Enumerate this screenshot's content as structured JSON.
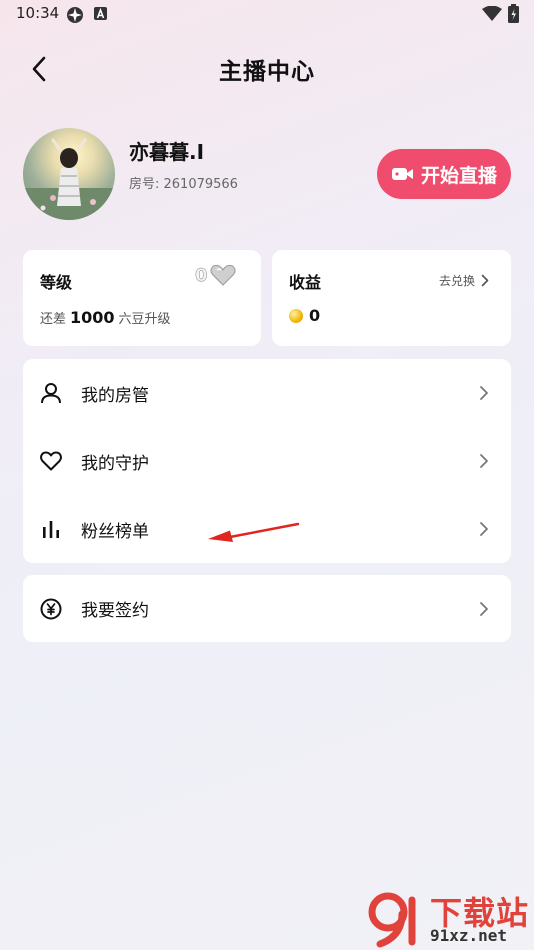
{
  "status_bar": {
    "time": "10:34",
    "icons": [
      "sync-icon",
      "a-icon",
      "wifi-icon",
      "battery-icon"
    ]
  },
  "header": {
    "title": "主播中心",
    "back_icon": "chevron-left-icon"
  },
  "profile": {
    "name": "亦暮暮.I",
    "room_label": "房号: 261079566",
    "live_button": "开始直播"
  },
  "level_card": {
    "title": "等级",
    "badge_number": "0",
    "prefix": "还差",
    "amount": "1000",
    "suffix": "六豆升级"
  },
  "income_card": {
    "title": "收益",
    "exchange": "去兑换",
    "value": "0"
  },
  "menu": {
    "items": [
      {
        "label": "我的房管",
        "icon": "user-icon"
      },
      {
        "label": "我的守护",
        "icon": "heart-icon"
      },
      {
        "label": "粉丝榜单",
        "icon": "bar-chart-icon"
      }
    ],
    "sign": {
      "label": "我要签约",
      "icon": "yen-icon"
    }
  },
  "watermark": {
    "title": "下载站",
    "url": "91xz.net",
    "logo_text": "9"
  },
  "colors": {
    "accent": "#f04d6e",
    "annotation_arrow": "#e0261f",
    "watermark": "#e0433b"
  }
}
